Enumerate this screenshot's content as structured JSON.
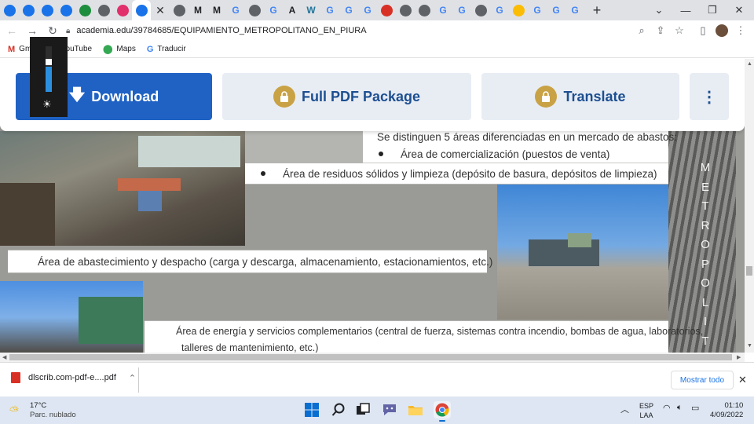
{
  "browser": {
    "tabs": [
      {
        "icon": "chrome-circle-icon",
        "color": "#1a73e8"
      },
      {
        "icon": "chrome-circle-icon",
        "color": "#1a73e8"
      },
      {
        "icon": "chrome-circle-icon",
        "color": "#1a73e8"
      },
      {
        "icon": "chrome-circle-icon",
        "color": "#1a73e8"
      },
      {
        "icon": "green-app-icon",
        "color": "#1e8e3e"
      },
      {
        "icon": "globe-icon",
        "color": "#5f6368"
      },
      {
        "icon": "instagram-icon",
        "color": "#e1306c"
      },
      {
        "icon": "chrome-circle-icon",
        "color": "#1a73e8",
        "active": true
      },
      {
        "icon": "globe-icon",
        "color": "#5f6368"
      },
      {
        "icon": "m-icon",
        "letter": "M",
        "color": "#202124"
      },
      {
        "icon": "m-icon",
        "letter": "M",
        "color": "#202124"
      },
      {
        "icon": "google-icon",
        "letter": "G",
        "color": "#4285f4"
      },
      {
        "icon": "image-icon",
        "color": "#5f6368"
      },
      {
        "icon": "google-icon",
        "letter": "G",
        "color": "#4285f4"
      },
      {
        "icon": "a-icon",
        "letter": "A",
        "color": "#202124"
      },
      {
        "icon": "wordpress-icon",
        "letter": "W",
        "color": "#21759b"
      },
      {
        "icon": "google-icon",
        "letter": "G",
        "color": "#4285f4"
      },
      {
        "icon": "google-icon",
        "letter": "G",
        "color": "#4285f4"
      },
      {
        "icon": "google-icon",
        "letter": "G",
        "color": "#4285f4"
      },
      {
        "icon": "tool-icon",
        "color": "#d93025"
      },
      {
        "icon": "globe-icon",
        "color": "#5f6368"
      },
      {
        "icon": "globe-icon",
        "color": "#5f6368"
      },
      {
        "icon": "google-icon",
        "letter": "G",
        "color": "#4285f4"
      },
      {
        "icon": "google-icon",
        "letter": "G",
        "color": "#4285f4"
      },
      {
        "icon": "globe-icon",
        "color": "#5f6368"
      },
      {
        "icon": "google-icon",
        "letter": "G",
        "color": "#4285f4"
      },
      {
        "icon": "drive-icon",
        "color": "#fbbc04"
      },
      {
        "icon": "google-icon",
        "letter": "G",
        "color": "#4285f4"
      },
      {
        "icon": "google-icon",
        "letter": "G",
        "color": "#4285f4"
      },
      {
        "icon": "google-icon",
        "letter": "G",
        "color": "#4285f4"
      }
    ],
    "new_tab": "+",
    "window_controls": {
      "collapse": "⌄",
      "minimize": "—",
      "restore": "❐",
      "close": "✕"
    },
    "url": "academia.edu/39784685/EQUIPAMIENTO_METROPOLITANO_EN_PIURA",
    "bookmarks": [
      {
        "label": "Gmail",
        "icon": "gmail-icon",
        "color": "#d93025",
        "glyph": "M"
      },
      {
        "label": "YouTube",
        "icon": "youtube-icon",
        "color": "#ff0000",
        "glyph": "▶"
      },
      {
        "label": "Maps",
        "icon": "maps-icon",
        "color": "#34a853",
        "glyph": "⬤"
      },
      {
        "label": "Traducir",
        "icon": "translate-icon",
        "color": "#4285f4",
        "glyph": "G"
      }
    ]
  },
  "page": {
    "download_label": "Download",
    "full_pdf_label": "Full PDF Package",
    "translate_label": "Translate",
    "more_label": "⋮",
    "brightness_level": 0.55,
    "document_lines": {
      "intro": "Se distinguen 5 áreas diferenciadas en un mercado de abastos:",
      "item1": "Área de comercialización (puestos de venta)",
      "item2": "Área de residuos sólidos y limpieza (depósito de basura, depósitos de limpieza)",
      "item3": "Área de abastecimiento y despacho (carga y descarga, almacenamiento, estacionamientos, etc.)",
      "item4a": "Área de energía y servicios complementarios (central de fuerza, sistemas contra incendio, bombas de agua, laboratorios,",
      "item4b": "talleres de mantenimiento, etc.)"
    },
    "vertical_letters": [
      "M",
      "E",
      "T",
      "R",
      "O",
      "P",
      "O",
      "L",
      "I",
      "T"
    ]
  },
  "download_shelf": {
    "filename": "dlscrib.com-pdf-e....pdf",
    "show_all": "Mostrar todo"
  },
  "taskbar": {
    "temperature": "17°C",
    "condition": "Parc. nublado",
    "language_line1": "ESP",
    "language_line2": "LAA",
    "time": "01:10",
    "date": "4/09/2022"
  }
}
